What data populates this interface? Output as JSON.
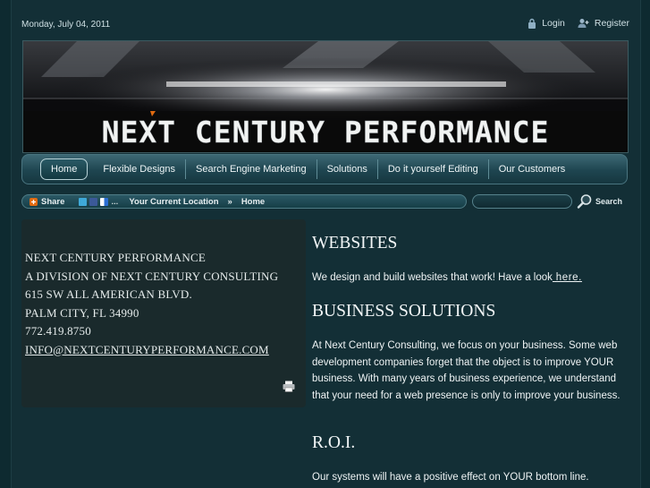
{
  "topbar": {
    "date": "Monday, July 04, 2011",
    "login": "Login",
    "register": "Register",
    "login_icon": "lock-icon",
    "register_icon": "user-add-icon"
  },
  "banner": {
    "title": "NEXT CENTURY PERFORMANCE"
  },
  "nav": {
    "items": [
      "Home",
      "Flexible Designs",
      "Search Engine Marketing",
      "Solutions",
      "Do it yourself Editing",
      "Our Customers"
    ],
    "active": "Home"
  },
  "toolbar": {
    "share": "Share",
    "share_icon": "share-plus-icon",
    "location_label": "Your Current Location",
    "separator": "»",
    "location": "Home"
  },
  "search": {
    "placeholder": "",
    "button": "Search",
    "icon": "magnifier-icon"
  },
  "contact": {
    "name": "NEXT CENTURY PERFORMANCE",
    "division": "A DIVISION OF NEXT CENTURY CONSULTING",
    "street": "615 SW ALL AMERICAN BLVD.",
    "city": "PALM CITY, FL 34990",
    "phone": "772.419.8750",
    "email": "INFO@NEXTCENTURYPERFORMANCE.COM",
    "print_icon": "printer-icon"
  },
  "content": {
    "h1": "WEBSITES",
    "p1": "We design and build websites that work!  Have a look",
    "p1_link": " here. ",
    "h2": "BUSINESS SOLUTIONS",
    "p2": "At Next Century Consulting, we focus on your business.  Some web development companies forget that the object is to improve YOUR business.  With many years of business experience, we understand that your need for a web presence is only to improve your business.",
    "h3": "R.O.I.",
    "p3": "Our systems will have a positive effect on YOUR bottom line."
  },
  "colors": {
    "background": "#0e2a30",
    "nav": "#1e4550",
    "panel": "#1a2a2c",
    "accent_orange": "#e06a10"
  }
}
